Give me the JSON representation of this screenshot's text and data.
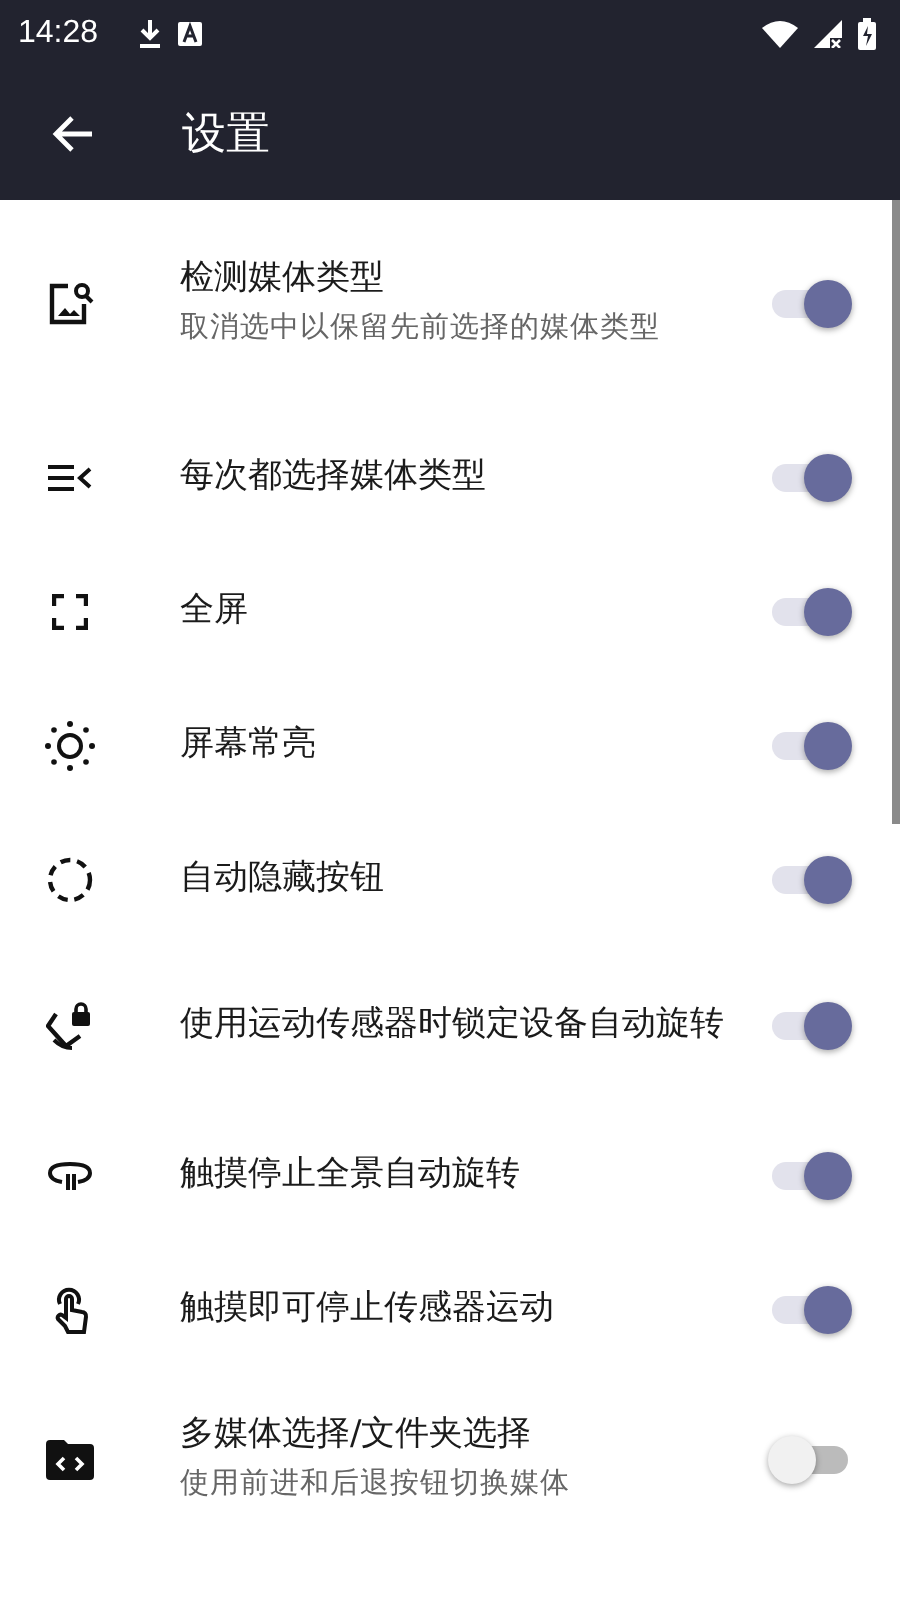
{
  "status_bar": {
    "time": "14:28"
  },
  "app_bar": {
    "title": "设置"
  },
  "settings": [
    {
      "title": "检测媒体类型",
      "subtitle": "取消选中以保留先前选择的媒体类型",
      "on": true
    },
    {
      "title": "每次都选择媒体类型",
      "on": true
    },
    {
      "title": "全屏",
      "on": true
    },
    {
      "title": "屏幕常亮",
      "on": true
    },
    {
      "title": "自动隐藏按钮",
      "on": true
    },
    {
      "title": "使用运动传感器时锁定设备自动旋转",
      "on": true
    },
    {
      "title": "触摸停止全景自动旋转",
      "on": true
    },
    {
      "title": "触摸即可停止传感器运动",
      "on": true
    },
    {
      "title": "多媒体选择/文件夹选择",
      "subtitle": "使用前进和后退按钮切换媒体",
      "on": false
    }
  ]
}
